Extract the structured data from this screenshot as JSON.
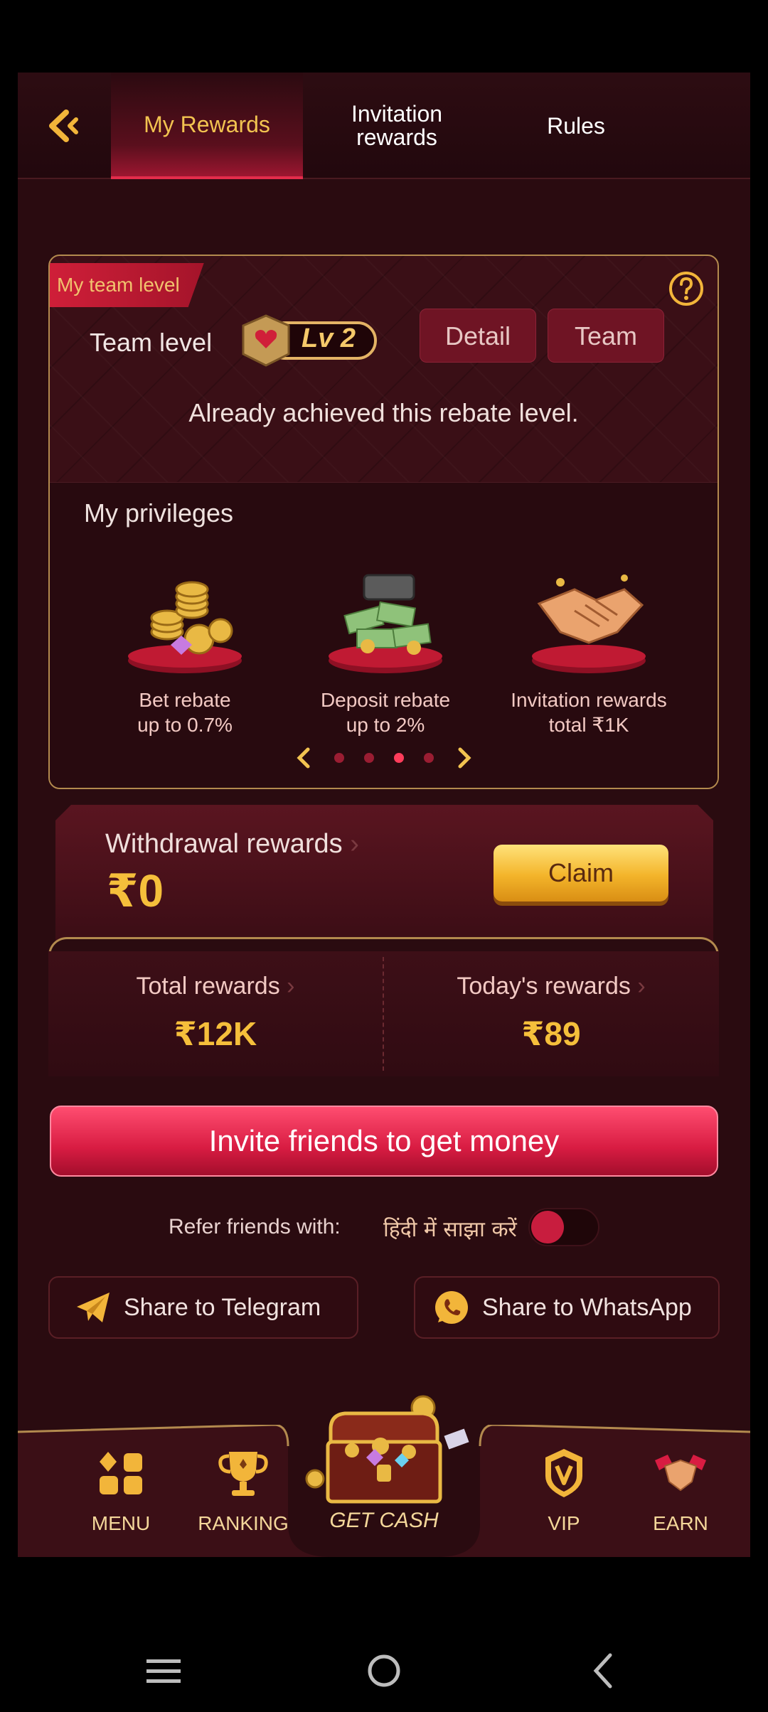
{
  "header": {
    "tabs": [
      {
        "label": "My Rewards",
        "active": true
      },
      {
        "label": "Invitation rewards",
        "active": false
      },
      {
        "label": "Rules",
        "active": false
      }
    ]
  },
  "team_card": {
    "ribbon": "My team level",
    "team_label": "Team level",
    "level_badge": "Lv 2",
    "detail_label": "Detail",
    "team_button_label": "Team",
    "status_text": "Already achieved this rebate level."
  },
  "privileges": {
    "title": "My privileges",
    "items": [
      {
        "line1": "Bet rebate",
        "line2": "up to 0.7%",
        "icon": "coins-icon"
      },
      {
        "line1": "Deposit rebate",
        "line2": "up to 2%",
        "icon": "money-chest-icon"
      },
      {
        "line1": "Invitation rewards",
        "line2": "total ₹1K",
        "icon": "handshake-icon"
      }
    ],
    "pager_total": 4,
    "pager_active": 3
  },
  "withdrawal": {
    "label": "Withdrawal rewards",
    "value": "₹0",
    "claim_label": "Claim"
  },
  "totals": {
    "total_label": "Total rewards",
    "total_value": "₹12K",
    "today_label": "Today's rewards",
    "today_value": "₹89"
  },
  "invite": {
    "label": "Invite friends to get money"
  },
  "refer": {
    "label": "Refer friends with:",
    "language": "हिंदी में साझा करें",
    "toggle_on": false
  },
  "share": {
    "telegram": "Share to Telegram",
    "whatsapp": "Share to WhatsApp"
  },
  "nav": {
    "menu": "MENU",
    "ranking": "RANKING",
    "get_cash": "GET CASH",
    "vip": "VIP",
    "earn": "EARN"
  },
  "colors": {
    "accent": "#e32c4b",
    "gold": "#f5bf3b",
    "background": "#2a0b10"
  }
}
